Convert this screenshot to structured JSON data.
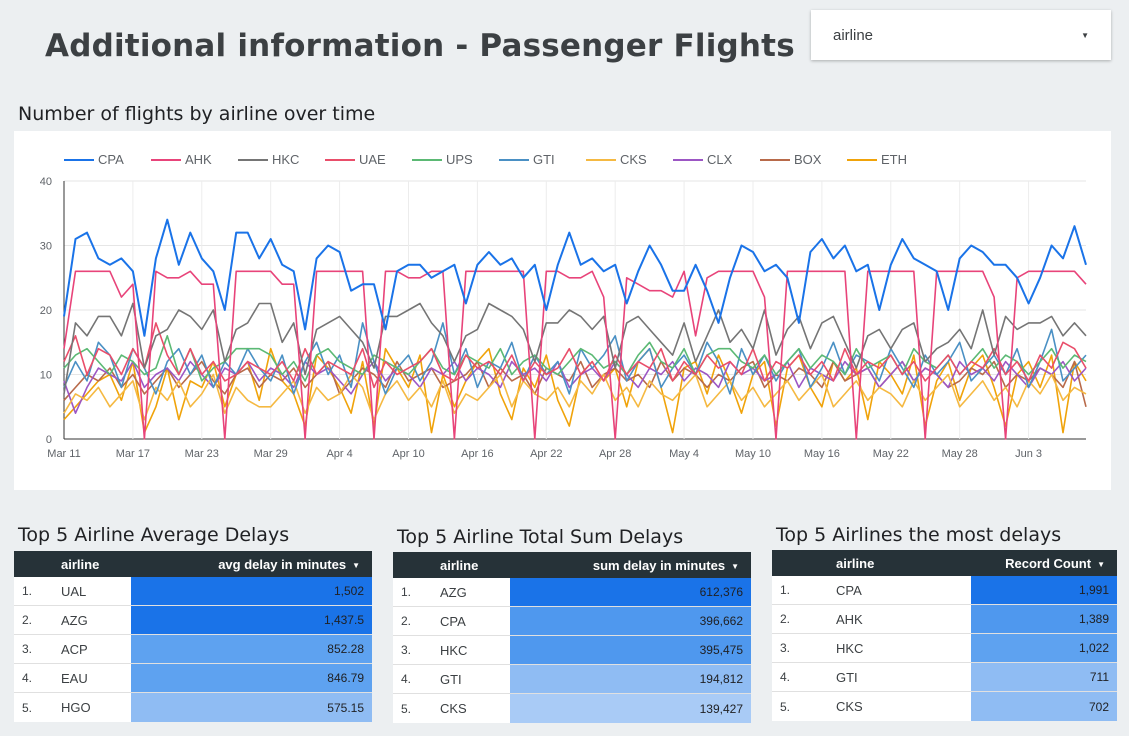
{
  "header": {
    "title": "Additional information - Passenger Flights"
  },
  "filter": {
    "label": "airline"
  },
  "chart_section": {
    "title": "Number of flights by airline over time"
  },
  "chart_data": {
    "type": "line",
    "ylim": [
      0,
      40
    ],
    "yticks": [
      0,
      10,
      20,
      30,
      40
    ],
    "xticks": [
      "Mar 11",
      "Mar 17",
      "Mar 23",
      "Mar 29",
      "Apr 4",
      "Apr 10",
      "Apr 16",
      "Apr 22",
      "Apr 28",
      "May 4",
      "May 10",
      "May 16",
      "May 22",
      "May 28",
      "Jun 3"
    ],
    "x_start": "Mar 11",
    "x_end": "Jun 11",
    "legend_position": "top",
    "grid": true,
    "series": [
      {
        "name": "CPA",
        "color": "#1a73e8",
        "values": [
          19,
          31,
          32,
          28,
          27,
          28,
          26,
          16,
          28,
          34,
          27,
          32,
          28,
          26,
          20,
          32,
          32,
          28,
          31,
          27,
          26,
          17,
          28,
          30,
          29,
          23,
          24,
          24,
          17,
          26,
          27,
          27,
          25,
          26,
          27,
          21,
          27,
          29,
          27,
          28,
          25,
          27,
          20,
          27,
          32,
          27,
          28,
          26,
          27,
          21,
          26,
          30,
          27,
          23,
          23,
          27,
          23,
          18,
          25,
          30,
          29,
          26,
          27,
          25,
          18,
          29,
          31,
          28,
          30,
          26,
          27,
          20,
          27,
          31,
          28,
          27,
          26,
          20,
          28,
          30,
          29,
          27,
          27,
          25,
          21,
          25,
          30,
          28,
          33,
          27
        ]
      },
      {
        "name": "AHK",
        "color": "#e8447a",
        "values": [
          14,
          26,
          26,
          26,
          26,
          22,
          24,
          0,
          26,
          25,
          25,
          26,
          24,
          24,
          0,
          26,
          26,
          26,
          26,
          24,
          24,
          0,
          26,
          26,
          26,
          26,
          26,
          0,
          26,
          26,
          25,
          25,
          26,
          26,
          0,
          26,
          26,
          26,
          26,
          26,
          26,
          0,
          26,
          26,
          25,
          25,
          26,
          22,
          0,
          25,
          24,
          23,
          23,
          22,
          26,
          16,
          25,
          26,
          26,
          26,
          26,
          22,
          0,
          26,
          26,
          26,
          26,
          26,
          26,
          0,
          26,
          26,
          26,
          26,
          26,
          0,
          26,
          26,
          26,
          26,
          26,
          22,
          0,
          25,
          26,
          26,
          26,
          26,
          26,
          24
        ]
      },
      {
        "name": "HKC",
        "color": "#757575",
        "values": [
          7,
          18,
          16,
          19,
          19,
          16,
          21,
          11,
          16,
          17,
          20,
          19,
          17,
          20,
          12,
          17,
          18,
          21,
          21,
          15,
          18,
          10,
          17,
          18,
          19,
          17,
          15,
          11,
          19,
          19,
          20,
          21,
          18,
          16,
          12,
          16,
          17,
          21,
          20,
          19,
          17,
          12,
          18,
          18,
          20,
          19,
          17,
          19,
          11,
          18,
          19,
          17,
          15,
          13,
          18,
          12,
          16,
          20,
          15,
          17,
          14,
          20,
          13,
          17,
          19,
          14,
          18,
          19,
          15,
          11,
          16,
          17,
          14,
          17,
          18,
          12,
          14,
          15,
          17,
          14,
          20,
          13,
          19,
          17,
          18,
          18,
          19,
          16,
          18,
          16
        ]
      },
      {
        "name": "UAE",
        "color": "#e94e6a",
        "values": [
          12,
          16,
          10,
          14,
          13,
          10,
          14,
          11,
          18,
          13,
          10,
          14,
          10,
          12,
          9,
          10,
          12,
          11,
          10,
          12,
          9,
          14,
          10,
          12,
          11,
          10,
          14,
          8,
          12,
          10,
          11,
          12,
          14,
          10,
          9,
          13,
          11,
          12,
          10,
          13,
          9,
          12,
          10,
          11,
          14,
          10,
          12,
          9,
          13,
          10,
          12,
          11,
          14,
          9,
          12,
          10,
          13,
          11,
          12,
          10,
          14,
          9,
          12,
          11,
          13,
          10,
          12,
          9,
          14,
          10,
          12,
          11,
          13,
          10,
          12,
          9,
          11,
          13,
          10,
          12,
          11,
          14,
          10,
          12,
          9,
          13,
          11,
          15,
          14,
          11
        ]
      },
      {
        "name": "UPS",
        "color": "#5bb974",
        "values": [
          11,
          13,
          14,
          12,
          10,
          13,
          12,
          10,
          11,
          16,
          10,
          14,
          9,
          11,
          12,
          14,
          14,
          14,
          13,
          10,
          12,
          9,
          13,
          14,
          12,
          11,
          10,
          13,
          12,
          11,
          10,
          12,
          14,
          11,
          10,
          13,
          12,
          11,
          14,
          10,
          12,
          13,
          11,
          10,
          12,
          14,
          13,
          11,
          12,
          10,
          13,
          15,
          12,
          11,
          14,
          10,
          13,
          14,
          14,
          12,
          11,
          13,
          10,
          12,
          14,
          11,
          13,
          12,
          10,
          14,
          11,
          12,
          13,
          10,
          14,
          12,
          11,
          13,
          10,
          12,
          14,
          11,
          13,
          12,
          10,
          12,
          14,
          11,
          13,
          12
        ]
      },
      {
        "name": "GTI",
        "color": "#4a90c4",
        "values": [
          8,
          12,
          9,
          15,
          13,
          8,
          14,
          11,
          7,
          12,
          14,
          10,
          13,
          8,
          12,
          10,
          14,
          11,
          9,
          13,
          7,
          12,
          15,
          10,
          13,
          8,
          18,
          12,
          7,
          11,
          13,
          9,
          12,
          18,
          10,
          14,
          8,
          12,
          11,
          15,
          9,
          13,
          10,
          12,
          7,
          14,
          11,
          13,
          16,
          9,
          12,
          14,
          8,
          11,
          13,
          10,
          15,
          12,
          7,
          14,
          10,
          13,
          9,
          12,
          14,
          8,
          11,
          15,
          10,
          13,
          12,
          9,
          14,
          11,
          8,
          13,
          10,
          12,
          15,
          9,
          11,
          13,
          10,
          14,
          8,
          12,
          17,
          9,
          11,
          13
        ]
      },
      {
        "name": "CKS",
        "color": "#f5b942",
        "values": [
          4,
          7,
          6,
          8,
          5,
          7,
          9,
          3,
          8,
          6,
          9,
          5,
          7,
          10,
          4,
          8,
          6,
          5,
          5,
          7,
          9,
          4,
          8,
          6,
          7,
          10,
          8,
          3,
          7,
          9,
          6,
          8,
          5,
          9,
          4,
          7,
          6,
          8,
          10,
          5,
          9,
          7,
          6,
          8,
          5,
          9,
          7,
          10,
          6,
          8,
          5,
          9,
          7,
          6,
          8,
          10,
          5,
          7,
          9,
          6,
          8,
          5,
          7,
          9,
          6,
          8,
          10,
          5,
          7,
          9,
          6,
          8,
          7,
          5,
          9,
          6,
          8,
          10,
          5,
          7,
          9,
          6,
          8,
          5,
          9,
          7,
          10,
          6,
          8,
          7
        ]
      },
      {
        "name": "CLX",
        "color": "#9c56c4",
        "values": [
          9,
          4,
          8,
          11,
          10,
          9,
          12,
          8,
          10,
          11,
          9,
          12,
          10,
          8,
          11,
          10,
          12,
          9,
          11,
          10,
          8,
          12,
          10,
          11,
          9,
          7,
          10,
          12,
          9,
          11,
          10,
          8,
          11,
          10,
          12,
          9,
          11,
          10,
          8,
          12,
          10,
          11,
          9,
          12,
          8,
          10,
          11,
          9,
          12,
          10,
          8,
          11,
          10,
          12,
          9,
          11,
          10,
          8,
          12,
          10,
          11,
          9,
          10,
          12,
          8,
          11,
          10,
          9,
          12,
          10,
          11,
          8,
          10,
          12,
          9,
          11,
          10,
          8,
          12,
          10,
          11,
          9,
          12,
          10,
          8,
          11,
          10,
          12,
          9,
          11
        ]
      },
      {
        "name": "BOX",
        "color": "#b86a4a",
        "values": [
          6,
          8,
          10,
          9,
          11,
          8,
          10,
          7,
          9,
          11,
          8,
          10,
          12,
          9,
          7,
          10,
          11,
          8,
          10,
          9,
          11,
          8,
          10,
          12,
          7,
          9,
          11,
          10,
          8,
          12,
          9,
          10,
          11,
          8,
          9,
          10,
          12,
          8,
          11,
          9,
          10,
          7,
          11,
          10,
          9,
          12,
          8,
          10,
          11,
          9,
          10,
          8,
          12,
          9,
          11,
          10,
          8,
          10,
          9,
          11,
          12,
          8,
          10,
          9,
          11,
          10,
          8,
          12,
          9,
          10,
          11,
          8,
          10,
          12,
          9,
          11,
          10,
          8,
          9,
          11,
          10,
          12,
          8,
          10,
          9,
          11,
          10,
          8,
          12,
          5
        ]
      },
      {
        "name": "ETH",
        "color": "#f0a30a",
        "values": [
          3,
          5,
          7,
          9,
          10,
          6,
          12,
          1,
          5,
          11,
          3,
          9,
          8,
          12,
          5,
          10,
          12,
          6,
          14,
          9,
          7,
          2,
          13,
          11,
          8,
          4,
          12,
          2,
          14,
          11,
          8,
          13,
          1,
          10,
          5,
          9,
          12,
          14,
          7,
          3,
          11,
          8,
          13,
          6,
          2,
          10,
          12,
          9,
          11,
          5,
          12,
          14,
          8,
          1,
          11,
          12,
          7,
          13,
          9,
          4,
          10,
          12,
          2,
          11,
          13,
          8,
          5,
          12,
          9,
          11,
          3,
          12,
          10,
          7,
          13,
          2,
          9,
          12,
          6,
          11,
          13,
          8,
          2,
          10,
          12,
          8,
          13,
          1,
          12,
          9
        ]
      }
    ]
  },
  "tables": [
    {
      "title": "Top 5 Airline Average Delays",
      "col_airline": "airline",
      "col_metric": "avg delay in minutes",
      "rows": [
        {
          "rank": "1.",
          "airline": "UAL",
          "value": "1,502",
          "level": 1.0
        },
        {
          "rank": "2.",
          "airline": "AZG",
          "value": "1,437.5",
          "level": 0.96
        },
        {
          "rank": "3.",
          "airline": "ACP",
          "value": "852.28",
          "level": 0.57
        },
        {
          "rank": "4.",
          "airline": "EAU",
          "value": "846.79",
          "level": 0.56
        },
        {
          "rank": "5.",
          "airline": "HGO",
          "value": "575.15",
          "level": 0.38
        }
      ]
    },
    {
      "title": "Top 5 Airline Total Sum Delays",
      "col_airline": "airline",
      "col_metric": "sum delay in minutes",
      "rows": [
        {
          "rank": "1.",
          "airline": "AZG",
          "value": "612,376",
          "level": 1.0
        },
        {
          "rank": "2.",
          "airline": "CPA",
          "value": "396,662",
          "level": 0.65
        },
        {
          "rank": "3.",
          "airline": "HKC",
          "value": "395,475",
          "level": 0.65
        },
        {
          "rank": "4.",
          "airline": "GTI",
          "value": "194,812",
          "level": 0.32
        },
        {
          "rank": "5.",
          "airline": "CKS",
          "value": "139,427",
          "level": 0.23
        }
      ]
    },
    {
      "title": "Top 5 Airlines the most delays",
      "col_airline": "airline",
      "col_metric": "Record Count",
      "rows": [
        {
          "rank": "1.",
          "airline": "CPA",
          "value": "1,991",
          "level": 1.0
        },
        {
          "rank": "2.",
          "airline": "AHK",
          "value": "1,389",
          "level": 0.7
        },
        {
          "rank": "3.",
          "airline": "HKC",
          "value": "1,022",
          "level": 0.51
        },
        {
          "rank": "4.",
          "airline": "GTI",
          "value": "711",
          "level": 0.36
        },
        {
          "rank": "5.",
          "airline": "CKS",
          "value": "702",
          "level": 0.35
        }
      ]
    }
  ]
}
